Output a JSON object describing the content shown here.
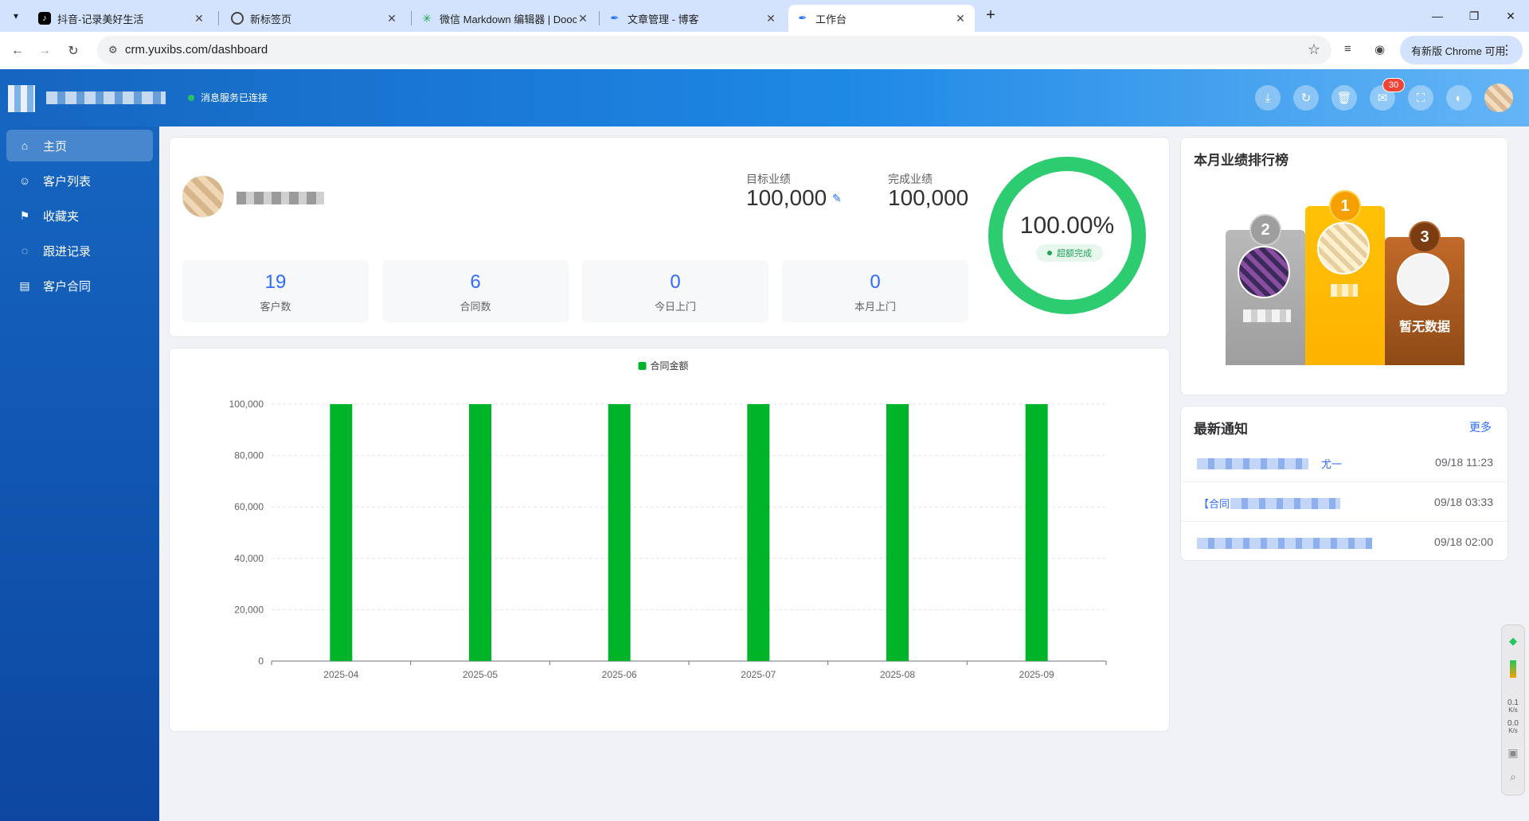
{
  "browser": {
    "tabs": [
      {
        "title": "抖音-记录美好生活",
        "favicon": "tiktok-icon"
      },
      {
        "title": "新标签页",
        "favicon": "globe-icon"
      },
      {
        "title": "微信 Markdown 编辑器 | Doocs",
        "favicon": "doocs-icon"
      },
      {
        "title": "文章管理 - 博客",
        "favicon": "feather-icon"
      },
      {
        "title": "工作台",
        "favicon": "feather-icon"
      }
    ],
    "url": "crm.yuxibs.com/dashboard",
    "update_label": "有新版 Chrome 可用"
  },
  "header": {
    "status_text": "消息服务已连接",
    "notification_count": "30",
    "accent_color": "#1e88e5"
  },
  "sidebar": {
    "items": [
      {
        "label": "主页",
        "icon": "home-icon"
      },
      {
        "label": "客户列表",
        "icon": "user-icon"
      },
      {
        "label": "收藏夹",
        "icon": "bookmark-icon"
      },
      {
        "label": "跟进记录",
        "icon": "chat-icon"
      },
      {
        "label": "客户合同",
        "icon": "document-icon"
      }
    ]
  },
  "profile": {
    "target_label": "目标业绩",
    "target_value": "100,000",
    "completed_label": "完成业绩",
    "completed_value": "100,000",
    "completion_percent": "100.00%",
    "completion_badge": "超额完成",
    "completion_fraction": 1.0,
    "stats": [
      {
        "value": "19",
        "label": "客户数"
      },
      {
        "value": "6",
        "label": "合同数"
      },
      {
        "value": "0",
        "label": "今日上门"
      },
      {
        "value": "0",
        "label": "本月上门"
      }
    ]
  },
  "ranking": {
    "title": "本月业绩排行榜",
    "empty_text": "暂无数据",
    "places": [
      "1",
      "2",
      "3"
    ]
  },
  "notices": {
    "title": "最新通知",
    "more_label": "更多",
    "items": [
      {
        "link_fragment": "尤一",
        "time": "09/18 11:23"
      },
      {
        "link_fragment": "【合同",
        "time": "09/18 03:33"
      },
      {
        "link_fragment": "",
        "time": "09/18 02:00"
      }
    ]
  },
  "floating_toolbar": {
    "upload_speed": "0.1",
    "download_speed": "0.0",
    "unit": "K/s"
  },
  "chart_data": {
    "type": "bar",
    "categories": [
      "2025-04",
      "2025-05",
      "2025-06",
      "2025-07",
      "2025-08",
      "2025-09"
    ],
    "series": [
      {
        "name": "合同金额",
        "values": [
          100000,
          100000,
          100000,
          100000,
          100000,
          100000
        ],
        "color": "#00b42a"
      }
    ],
    "ylim": [
      0,
      100000
    ],
    "yticks": [
      0,
      20000,
      40000,
      60000,
      80000,
      100000
    ],
    "ytick_labels": [
      "0",
      "20,000",
      "40,000",
      "60,000",
      "80,000",
      "100,000"
    ],
    "grid": true,
    "legend": "top-center"
  }
}
